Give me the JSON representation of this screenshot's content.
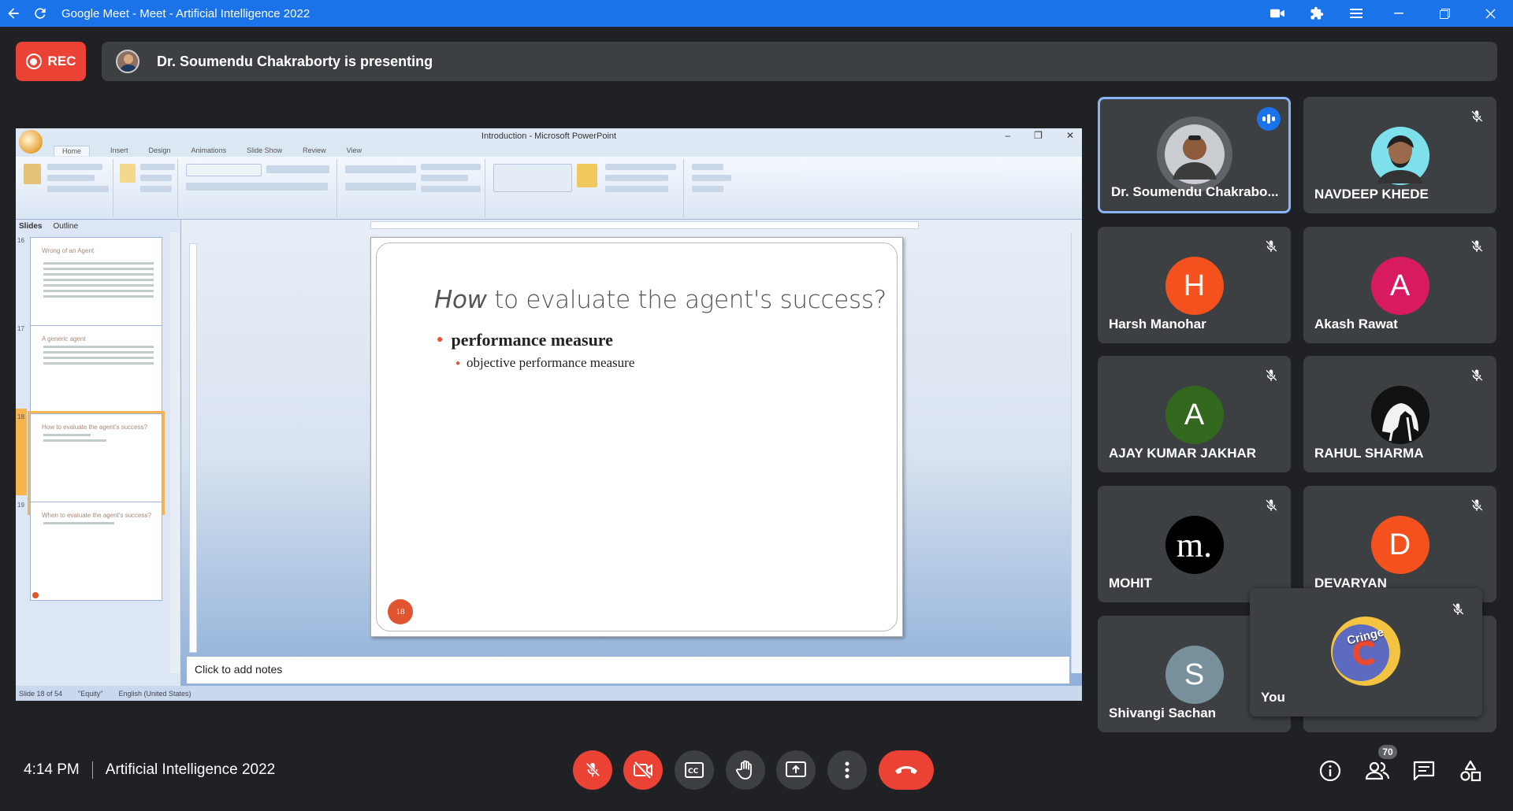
{
  "browser": {
    "title": "Google Meet - Meet - Artificial Intelligence 2022"
  },
  "topbar": {
    "rec_label": "REC",
    "presenting_text": "Dr. Soumendu Chakraborty is presenting"
  },
  "powerpoint": {
    "window_title": "Introduction - Microsoft PowerPoint",
    "ribbon_tabs": [
      "Home",
      "Insert",
      "Design",
      "Animations",
      "Slide Show",
      "Review",
      "View"
    ],
    "panel_tabs": [
      "Slides",
      "Outline"
    ],
    "thumbnails": [
      {
        "num": "16",
        "title": "Wrong of an Agent"
      },
      {
        "num": "17",
        "title": "A generic agent"
      },
      {
        "num": "18",
        "title": "How to evaluate the agent's success?"
      },
      {
        "num": "19",
        "title": "When to evaluate the agent's success?"
      }
    ],
    "slide": {
      "title_italic": "How",
      "title_rest": " to evaluate the agent's success?",
      "bullet1": "performance measure",
      "bullet2": "objective performance measure",
      "number": "18"
    },
    "notes_placeholder": "Click to add notes",
    "status": [
      "Slide 18 of 54",
      "\"Equity\"",
      "English (United States)"
    ]
  },
  "participants": [
    {
      "name": "Dr. Soumendu Chakrabo...",
      "speaking": true,
      "avatar_type": "photo",
      "avatar_color": "#6d4c41"
    },
    {
      "name": "NAVDEEP KHEDE",
      "muted": true,
      "avatar_type": "photo",
      "avatar_color": "#26c6da"
    },
    {
      "name": "Harsh Manohar",
      "muted": true,
      "initial": "H",
      "avatar_color": "#f4511e"
    },
    {
      "name": "Akash Rawat",
      "muted": true,
      "initial": "A",
      "avatar_color": "#d81b60"
    },
    {
      "name": "AJAY KUMAR JAKHAR",
      "muted": true,
      "initial": "A",
      "avatar_color": "#33691e"
    },
    {
      "name": "RAHUL SHARMA",
      "muted": true,
      "avatar_type": "photo",
      "avatar_color": "#111111"
    },
    {
      "name": "MOHIT",
      "muted": true,
      "initial": "m.",
      "avatar_color": "#000000"
    },
    {
      "name": "DEVARYAN",
      "muted": true,
      "initial": "D",
      "avatar_color": "#f4511e"
    },
    {
      "name": "Shivangi Sachan",
      "initial": "S",
      "avatar_color": "#78909c"
    },
    {
      "name": "You",
      "muted": true,
      "avatar_text": "Cringe",
      "avatar_color": "#5c6bc0"
    }
  ],
  "bottombar": {
    "time": "4:14 PM",
    "meeting_name": "Artificial Intelligence 2022",
    "people_count": "70"
  },
  "colors": {
    "chrome_blue": "#1a73e8",
    "meet_bg": "#202124",
    "tile_bg": "#3c4043",
    "danger_red": "#ea4335",
    "active_outline": "#8ab4f8"
  }
}
